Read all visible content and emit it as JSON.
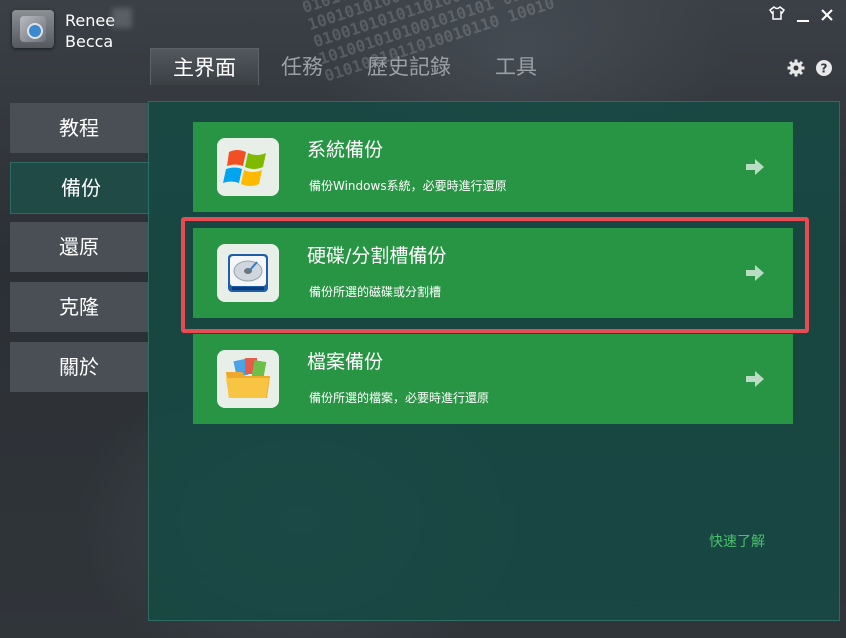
{
  "app": {
    "brand_line1": "Renee",
    "brand_line2": "Becca"
  },
  "window_controls": [
    "shirt-icon",
    "minimize-icon",
    "close-icon"
  ],
  "tabs": [
    {
      "label": "主界面",
      "active": true
    },
    {
      "label": "任務",
      "active": false
    },
    {
      "label": "歷史記錄",
      "active": false
    },
    {
      "label": "工具",
      "active": false
    }
  ],
  "header_icons": [
    "gear-icon",
    "help-icon"
  ],
  "sidebar": [
    {
      "label": "教程",
      "active": false
    },
    {
      "label": "備份",
      "active": true
    },
    {
      "label": "還原",
      "active": false
    },
    {
      "label": "克隆",
      "active": false
    },
    {
      "label": "關於",
      "active": false
    }
  ],
  "cards": [
    {
      "title": "系統備份",
      "desc": "備份Windows系統，必要時進行還原",
      "icon": "windows-logo-icon"
    },
    {
      "title": "硬碟/分割槽備份",
      "desc": "備份所選的磁碟或分割槽",
      "icon": "hard-disk-icon",
      "highlighted": true
    },
    {
      "title": "檔案備份",
      "desc": "備份所選的檔案，必要時進行還原",
      "icon": "folder-icon"
    }
  ],
  "quick_link": "快速了解",
  "colors": {
    "card_green": "#289544",
    "panel_teal": "#164a44",
    "highlight_red": "#e94b55",
    "link_green": "#49c06a"
  }
}
